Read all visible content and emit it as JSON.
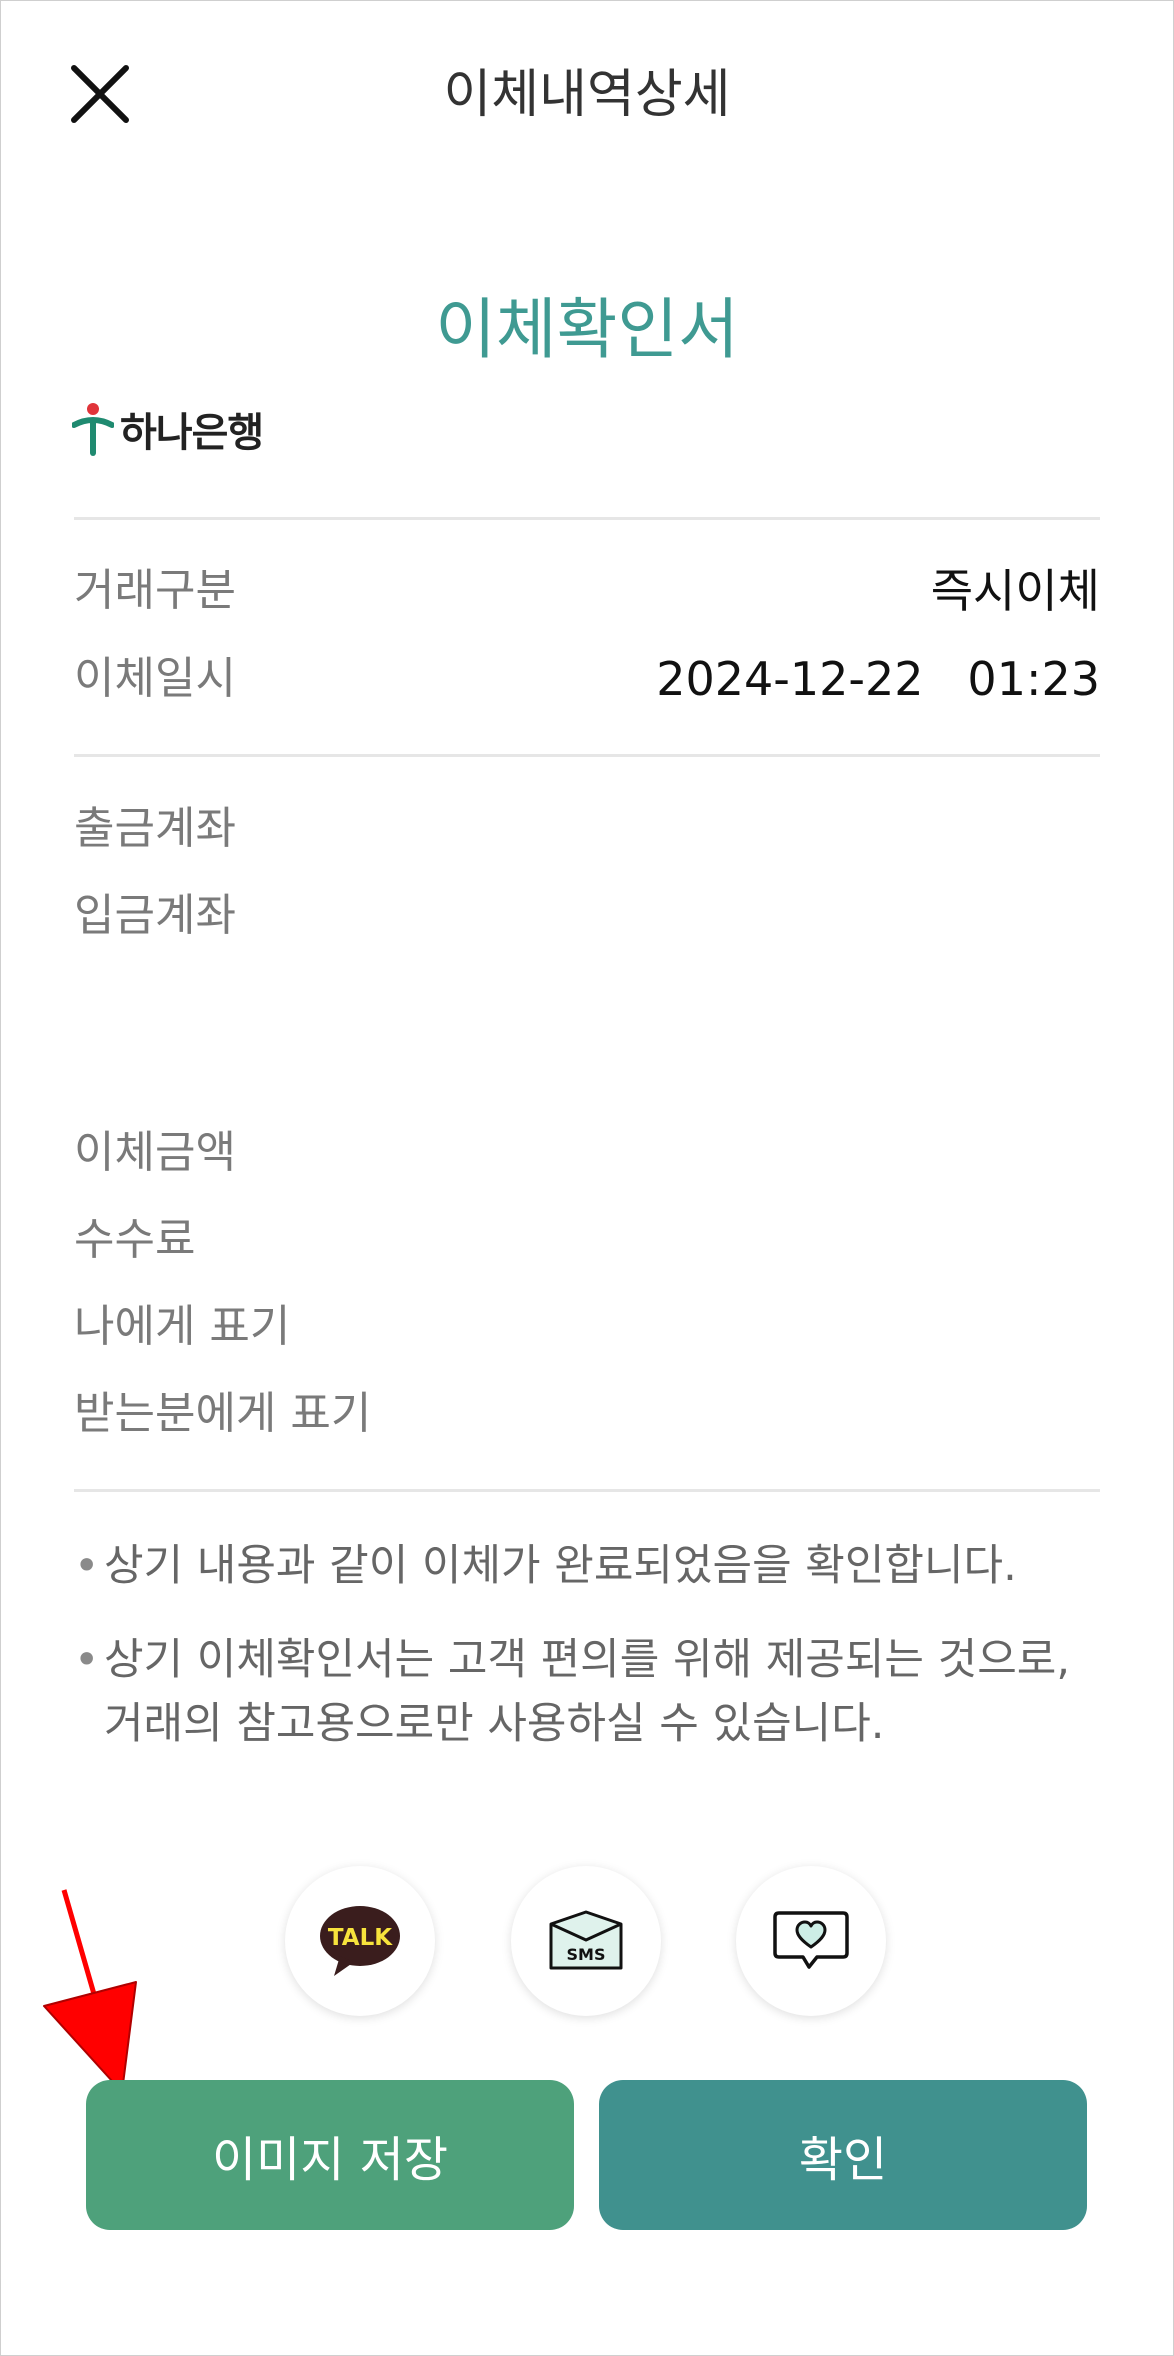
{
  "header": {
    "title": "이체내역상세"
  },
  "document": {
    "title": "이체확인서"
  },
  "bank": {
    "name": "하나은행"
  },
  "summary": [
    {
      "label": "거래구분",
      "value": "즉시이체"
    },
    {
      "label": "이체일시",
      "value": "2024-12-22   01:23"
    }
  ],
  "accounts": [
    {
      "label": "출금계좌"
    },
    {
      "label": "입금계좌"
    }
  ],
  "details": [
    {
      "label": "이체금액"
    },
    {
      "label": "수수료"
    },
    {
      "label": "나에게 표기"
    },
    {
      "label": "받는분에게 표기"
    }
  ],
  "notes": [
    "상기 내용과 같이 이체가 완료되었음을 확인합니다.",
    "상기 이체확인서는 고객 편의를 위해 제공되는 것으로, 거래의 참고용으로만 사용하실 수 있습니다."
  ],
  "share": {
    "talk_icon_text": "TALK",
    "sms_icon_text": "SMS"
  },
  "buttons": {
    "save_image": "이미지 저장",
    "confirm": "확인"
  },
  "colors": {
    "accent": "#3f9a92",
    "save_button": "#4ea17b",
    "confirm_button": "#40918e",
    "annotation_arrow": "#ff0000"
  }
}
